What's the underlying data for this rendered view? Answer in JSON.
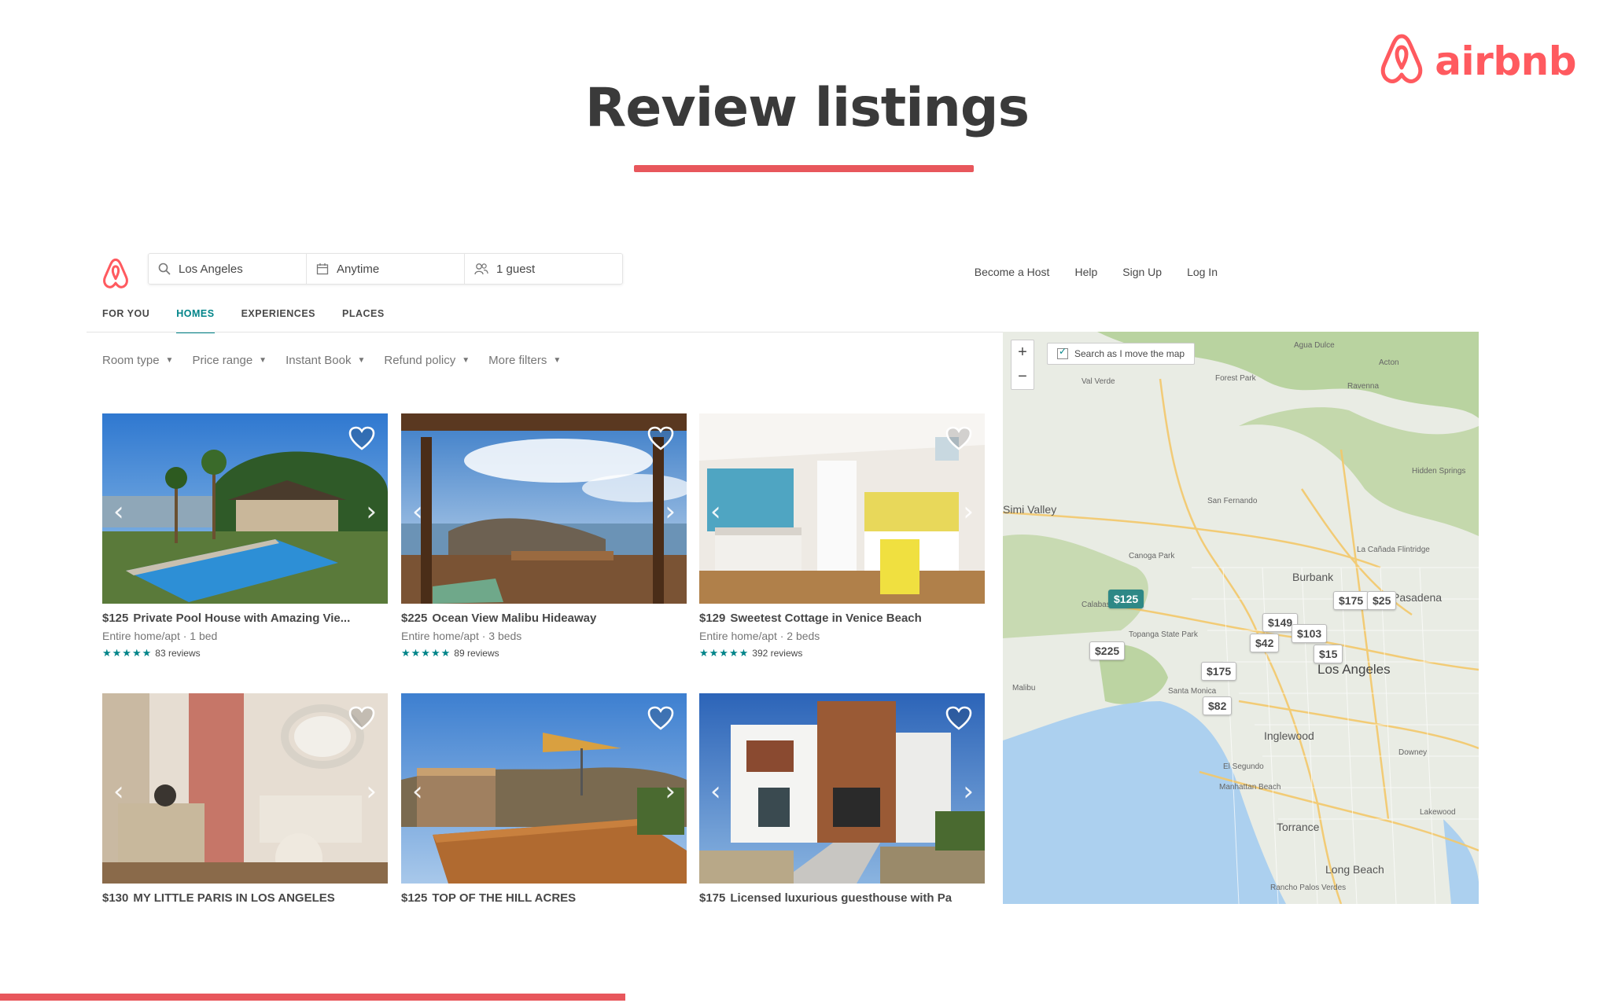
{
  "slide": {
    "title": "Review listings",
    "brand": "airbnb",
    "colors": {
      "accent": "#e8575c",
      "brand": "#ff5a5f",
      "teal": "#008489"
    }
  },
  "app": {
    "search": {
      "location": "Los Angeles",
      "dates": "Anytime",
      "guests": "1 guest"
    },
    "top_links": [
      "Become a Host",
      "Help",
      "Sign Up",
      "Log In"
    ],
    "tabs": [
      {
        "label": "FOR YOU",
        "active": false
      },
      {
        "label": "HOMES",
        "active": true
      },
      {
        "label": "EXPERIENCES",
        "active": false
      },
      {
        "label": "PLACES",
        "active": false
      }
    ],
    "filters": [
      "Room type",
      "Price range",
      "Instant Book",
      "Refund policy",
      "More filters"
    ],
    "listings": [
      {
        "price": "$125",
        "title": "Private Pool House with Amazing Vie...",
        "subtitle": "Entire home/apt · 1 bed",
        "reviews": "83 reviews",
        "photo": "pool"
      },
      {
        "price": "$225",
        "title": "Ocean View Malibu Hideaway",
        "subtitle": "Entire home/apt · 3 beds",
        "reviews": "89 reviews",
        "photo": "ocean"
      },
      {
        "price": "$129",
        "title": "Sweetest Cottage in Venice Beach",
        "subtitle": "Entire home/apt · 2 beds",
        "reviews": "392 reviews",
        "photo": "cottage"
      },
      {
        "price": "$130",
        "title": "MY LITTLE PARIS IN LOS ANGELES",
        "photo": "paris"
      },
      {
        "price": "$125",
        "title": "TOP OF THE HILL ACRES",
        "photo": "hill"
      },
      {
        "price": "$175",
        "title": "Licensed luxurious guesthouse with Pa",
        "photo": "modern"
      }
    ],
    "map": {
      "zoom_in": "+",
      "zoom_out": "−",
      "search_toggle": "Search as I move the map",
      "places": [
        "Agua Dulce",
        "Acton",
        "Val Verde",
        "Forest Park",
        "Ravenna",
        "Simi Valley",
        "San Fernando",
        "Burbank",
        "La Cañada Flintridge",
        "Pasadena",
        "Topanga State Park",
        "Los Angeles",
        "Malibu",
        "Santa Monica",
        "Inglewood",
        "Downey",
        "El Segundo",
        "Manhattan Beach",
        "Torrance",
        "Lakewood",
        "Long Beach",
        "Calabasas",
        "Canoga Park",
        "Hidden Springs",
        "Rancho Palos Verdes"
      ],
      "pins": [
        "$125",
        "$225",
        "$149",
        "$175",
        "$42",
        "$103",
        "$15",
        "$175",
        "$82",
        "$25"
      ]
    }
  }
}
